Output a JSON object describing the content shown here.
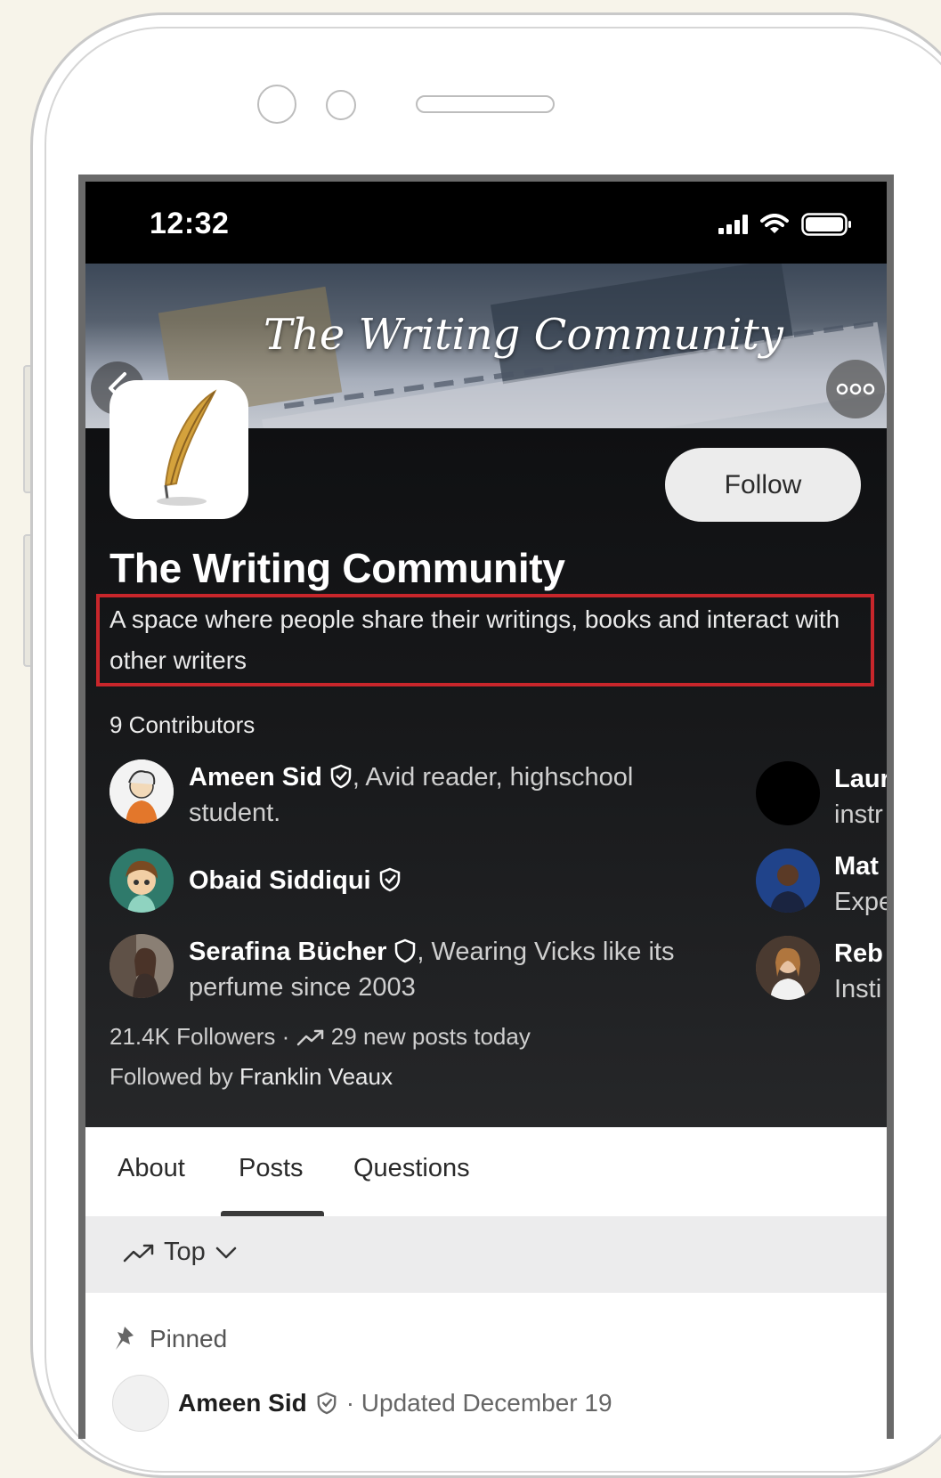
{
  "status_bar": {
    "time": "12:32"
  },
  "banner": {
    "title": "The Writing Community"
  },
  "community": {
    "name": "The Writing Community",
    "description": "A space where people share their writings, books and interact with other writers",
    "follow_label": "Follow",
    "contributors_label": "9 Contributors"
  },
  "contributors_left": [
    {
      "name": "Ameen Sid",
      "bio": ", Avid reader, highschool student."
    },
    {
      "name": "Obaid Siddiqui",
      "bio": ""
    },
    {
      "name": "Serafina Bücher",
      "bio": ", Wearing Vicks like its perfume since 2003"
    }
  ],
  "contributors_right": [
    {
      "name": "Laur",
      "bio": "instr"
    },
    {
      "name": "Mat",
      "bio": "Expe"
    },
    {
      "name": "Reb",
      "bio": "Insti"
    }
  ],
  "stats": {
    "followers": "21.4K Followers",
    "separator": "·",
    "new_posts": "29 new posts today",
    "followed_by_prefix": "Followed by",
    "followed_by_name": "Franklin Veaux"
  },
  "tabs": [
    "About",
    "Posts",
    "Questions"
  ],
  "active_tab": "Posts",
  "sort": {
    "label": "Top"
  },
  "feed": {
    "pinned_label": "Pinned",
    "first_post_author": "Ameen Sid",
    "first_post_meta": "· Updated December 19"
  },
  "colors": {
    "highlight_box": "#c8262b",
    "hero_bg": "#18191b",
    "follow_bg": "#ececec"
  }
}
